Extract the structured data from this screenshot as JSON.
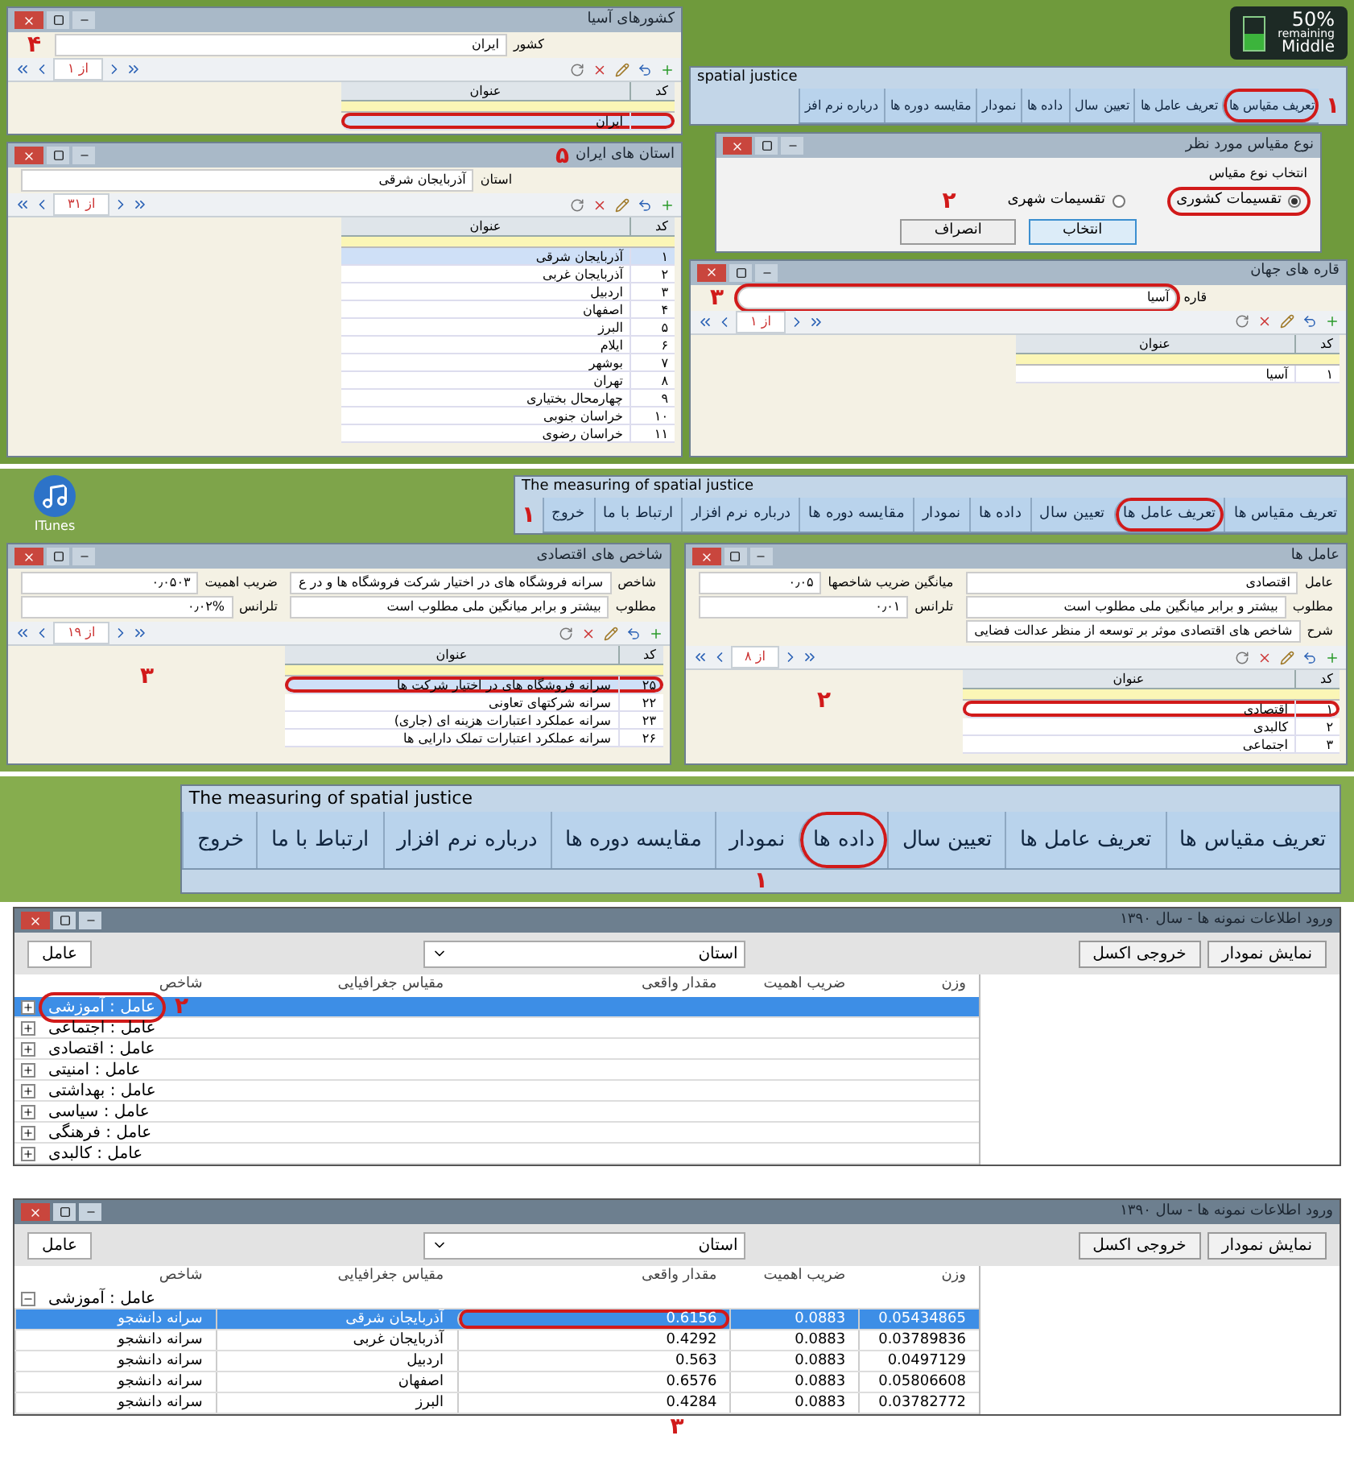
{
  "band1": {
    "country_window": {
      "title": "کشورهای آسیا",
      "field_label": "کشور",
      "field_value": "ایران",
      "pager": "از ۱",
      "columns": [
        "کد",
        "عنوان"
      ],
      "annotation": "۴",
      "rows": [
        {
          "code": "",
          "title": "ایران",
          "selected": true,
          "circled": true
        }
      ]
    },
    "province_window": {
      "title": "استان های ایران",
      "field_label": "استان",
      "field_value": "آذربایجان شرقی",
      "pager": "از ۳۱",
      "columns": [
        "کد",
        "عنوان"
      ],
      "annotation": "۵",
      "rows": [
        {
          "code": "۱",
          "title": "آذربایجان شرقی",
          "selected": true,
          "circled": false
        },
        {
          "code": "۲",
          "title": "آذربایجان غربی",
          "selected": false,
          "circled": false
        },
        {
          "code": "۳",
          "title": "اردبیل",
          "selected": false,
          "circled": false
        },
        {
          "code": "۴",
          "title": "اصفهان",
          "selected": false,
          "circled": false
        },
        {
          "code": "۵",
          "title": "البرز",
          "selected": false,
          "circled": false
        },
        {
          "code": "۶",
          "title": "ایلام",
          "selected": false,
          "circled": false
        },
        {
          "code": "۷",
          "title": "بوشهر",
          "selected": false,
          "circled": false
        },
        {
          "code": "۸",
          "title": "تهران",
          "selected": false,
          "circled": false
        },
        {
          "code": "۹",
          "title": "چهارمحال بختیاری",
          "selected": false,
          "circled": false
        },
        {
          "code": "۱۰",
          "title": "خراسان جنوبی",
          "selected": false,
          "circled": false
        },
        {
          "code": "۱۱",
          "title": "خراسان رضوی",
          "selected": false,
          "circled": false
        }
      ]
    },
    "battery": {
      "percent": "50%",
      "status": "remaining",
      "mode": "Middle",
      "level": 0.5
    },
    "app": {
      "title": "spatial justice",
      "annotation": "۱",
      "menu": [
        {
          "label": "تعریف مقیاس ها",
          "circled": true
        },
        {
          "label": "تعریف عامل ها",
          "circled": false
        },
        {
          "label": "تعیین سال",
          "circled": false
        },
        {
          "label": "داده ها",
          "circled": false
        },
        {
          "label": "نمودار",
          "circled": false
        },
        {
          "label": "مقایسه دوره ها",
          "circled": false
        },
        {
          "label": "درباره نرم افز",
          "circled": false
        }
      ]
    },
    "scale_dialog": {
      "title": "نوع مقیاس مورد نظر",
      "group_label": "انتخاب نوع مقیاس",
      "annotation": "۲",
      "options": [
        {
          "label": "تقسیمات کشوری",
          "selected": true
        },
        {
          "label": "تقسیمات شهری",
          "selected": false
        }
      ],
      "buttons": [
        "انتخاب",
        "انصراف"
      ]
    },
    "continent_window": {
      "title": "قاره های جهان",
      "field_label": "قاره",
      "field_value": "آسیا",
      "pager": "از ۱",
      "columns": [
        "کد",
        "عنوان"
      ],
      "annotation": "۳",
      "field_circled": true,
      "rows": [
        {
          "code": "۱",
          "title": "آسیا",
          "selected": false,
          "circled": false
        }
      ]
    }
  },
  "band2": {
    "desktop_icon_label": "ITunes",
    "app": {
      "title": "The measuring of spatial justice",
      "annotation": "۱",
      "menu": [
        {
          "label": "تعریف مقیاس ها",
          "circled": false
        },
        {
          "label": "تعریف عامل ها",
          "circled": true
        },
        {
          "label": "تعیین سال",
          "circled": false
        },
        {
          "label": "داده ها",
          "circled": false
        },
        {
          "label": "نمودار",
          "circled": false
        },
        {
          "label": "مقایسه دوره ها",
          "circled": false
        },
        {
          "label": "درباره نرم افزار",
          "circled": false
        },
        {
          "label": "ارتباط با ما",
          "circled": false
        },
        {
          "label": "خروج",
          "circled": false
        }
      ]
    },
    "indicator_window": {
      "title": "شاخص های اقتصادی",
      "annotation": "۳",
      "pager": "از ۱۹",
      "fields": [
        {
          "label": "شاخص",
          "value": "سرانه فروشگاه های در اختیار شرکت فروشگاه ها و در ع"
        },
        {
          "label": "ضریب اهمیت",
          "value": "۰٫۰۵۰۳"
        },
        {
          "label": "مطلوب",
          "value": "بیشتر و برابر میانگین ملی مطلوب است"
        },
        {
          "label": "تلرانس",
          "value": "۰٫۰۲%"
        }
      ],
      "columns": [
        "کد",
        "عنوان"
      ],
      "rows": [
        {
          "code": "۲۵",
          "title": "سرانه فروشگاه های در اختیار شرکت ها",
          "selected": true,
          "circled": true
        },
        {
          "code": "۲۲",
          "title": "سرانه شرکتهای تعاونی",
          "selected": false,
          "circled": false
        },
        {
          "code": "۲۳",
          "title": "سرانه عملکرد اعتبارات هزینه ای (جاری)",
          "selected": false,
          "circled": false
        },
        {
          "code": "۲۶",
          "title": "سرانه عملکرد اعتبارات تملک دارایی ها",
          "selected": false,
          "circled": false
        }
      ]
    },
    "factor_window": {
      "title": "عامل ها",
      "annotation": "۲",
      "pager": "از ۸",
      "fields": [
        {
          "label": "عامل",
          "value": "اقتصادی"
        },
        {
          "label": "میانگین ضریب شاخصها",
          "value": "۰٫۰۵"
        },
        {
          "label": "مطلوب",
          "value": "بیشتر و برابر میانگین ملی مطلوب است"
        },
        {
          "label": "تلرانس",
          "value": "۰٫۰۱"
        },
        {
          "label": "شرح",
          "value": "شاخص های اقتصادی موثر بر توسعه از منظر عدالت فضایی"
        }
      ],
      "columns": [
        "کد",
        "عنوان"
      ],
      "rows": [
        {
          "code": "۱",
          "title": "اقتصادی",
          "selected": false,
          "circled": true
        },
        {
          "code": "۲",
          "title": "کالبدی",
          "selected": false,
          "circled": false
        },
        {
          "code": "۳",
          "title": "اجتماعی",
          "selected": false,
          "circled": false
        }
      ]
    }
  },
  "band3": {
    "app": {
      "title": "The measuring of spatial justice",
      "annotation": "۱",
      "menu": [
        {
          "label": "تعریف مقیاس ها",
          "circled": false
        },
        {
          "label": "تعریف عامل ها",
          "circled": false
        },
        {
          "label": "تعیین سال",
          "circled": false
        },
        {
          "label": "داده ها",
          "circled": true
        },
        {
          "label": "نمودار",
          "circled": false
        },
        {
          "label": "مقایسه دوره ها",
          "circled": false
        },
        {
          "label": "درباره نرم افزار",
          "circled": false
        },
        {
          "label": "ارتباط با ما",
          "circled": false
        },
        {
          "label": "خروج",
          "circled": false
        }
      ]
    }
  },
  "data_windows": [
    {
      "title": "ورود اطلاعات نمونه ها - سال ۱۳۹۰",
      "buttons": [
        "نمایش نمودار",
        "خروجی اکسل"
      ],
      "scale_select": "استان",
      "group_chip": "عامل",
      "annotation": "۲",
      "columns": [
        "وزن",
        "ضریب اهمیت",
        "مقدار واقعی",
        "مقیاس جغرافیایی",
        "شاخص"
      ],
      "groups": [
        {
          "label": "عامل : آموزشی",
          "expanded": false,
          "selected": true,
          "circled": true
        },
        {
          "label": "عامل : اجتماعی",
          "expanded": false,
          "selected": false,
          "circled": false
        },
        {
          "label": "عامل : اقتصادی",
          "expanded": false,
          "selected": false,
          "circled": false
        },
        {
          "label": "عامل : امنیتی",
          "expanded": false,
          "selected": false,
          "circled": false
        },
        {
          "label": "عامل : بهداشتی",
          "expanded": false,
          "selected": false,
          "circled": false
        },
        {
          "label": "عامل : سیاسی",
          "expanded": false,
          "selected": false,
          "circled": false
        },
        {
          "label": "عامل : فرهنگی",
          "expanded": false,
          "selected": false,
          "circled": false
        },
        {
          "label": "عامل : کالبدی",
          "expanded": false,
          "selected": false,
          "circled": false
        }
      ]
    },
    {
      "title": "ورود اطلاعات نمونه ها - سال ۱۳۹۰",
      "buttons": [
        "نمایش نمودار",
        "خروجی اکسل"
      ],
      "scale_select": "استان",
      "group_chip": "عامل",
      "annotation": "۳",
      "columns": [
        "وزن",
        "ضریب اهمیت",
        "مقدار واقعی",
        "مقیاس جغرافیایی",
        "شاخص"
      ],
      "groups": [
        {
          "label": "عامل : آموزشی",
          "expanded": true,
          "selected": false,
          "circled": false,
          "rows": [
            {
              "cells": [
                "0.05434865",
                "0.0883",
                "0.6156",
                "آذربایجان شرقی",
                "سرانه دانشجو"
              ],
              "selected": true,
              "circled": true
            },
            {
              "cells": [
                "0.03789836",
                "0.0883",
                "0.4292",
                "آذربایجان غربی",
                "سرانه دانشجو"
              ],
              "selected": false,
              "circled": false
            },
            {
              "cells": [
                "0.0497129",
                "0.0883",
                "0.563",
                "اردبیل",
                "سرانه دانشجو"
              ],
              "selected": false,
              "circled": false
            },
            {
              "cells": [
                "0.05806608",
                "0.0883",
                "0.6576",
                "اصفهان",
                "سرانه دانشجو"
              ],
              "selected": false,
              "circled": false
            },
            {
              "cells": [
                "0.03782772",
                "0.0883",
                "0.4284",
                "البرز",
                "سرانه دانشجو"
              ],
              "selected": false,
              "circled": false
            }
          ]
        }
      ]
    }
  ]
}
